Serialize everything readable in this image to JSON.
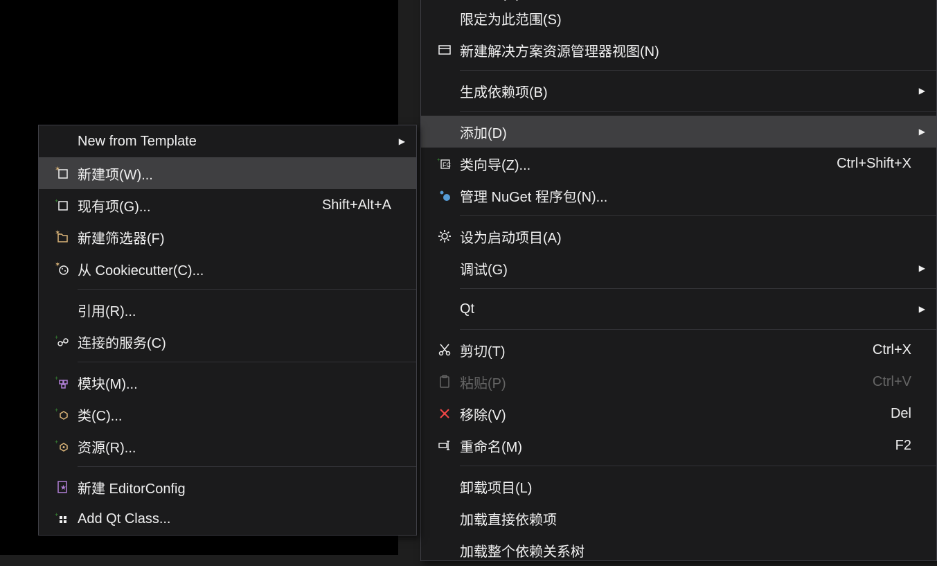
{
  "main_menu": [
    {
      "label": "重建…(R)",
      "icon": "",
      "clipped": true
    },
    {
      "label": "限定为此范围(S)"
    },
    {
      "label": "新建解决方案资源管理器视图(N)",
      "icon": "new-view-icon"
    },
    {
      "sep": true
    },
    {
      "label": "生成依赖项(B)",
      "arrow": true
    },
    {
      "sep": true
    },
    {
      "label": "添加(D)",
      "arrow": true,
      "highlight": true
    },
    {
      "label": "类向导(Z)...",
      "icon": "class-wizard-icon",
      "shortcut": "Ctrl+Shift+X"
    },
    {
      "label": "管理 NuGet 程序包(N)...",
      "icon": "nuget-icon"
    },
    {
      "sep": true
    },
    {
      "label": "设为启动项目(A)",
      "icon": "gear-icon"
    },
    {
      "label": "调试(G)",
      "arrow": true
    },
    {
      "sep": true
    },
    {
      "label": "Qt",
      "arrow": true
    },
    {
      "sep": true
    },
    {
      "label": "剪切(T)",
      "icon": "cut-icon",
      "shortcut": "Ctrl+X"
    },
    {
      "label": "粘贴(P)",
      "icon": "paste-icon",
      "shortcut": "Ctrl+V",
      "disabled": true
    },
    {
      "label": "移除(V)",
      "icon": "remove-icon",
      "shortcut": "Del"
    },
    {
      "label": "重命名(M)",
      "icon": "rename-icon",
      "shortcut": "F2"
    },
    {
      "sep": true
    },
    {
      "label": "卸载项目(L)"
    },
    {
      "label": "加载直接依赖项"
    },
    {
      "label": "加载整个依赖关系树"
    }
  ],
  "sub_menu": [
    {
      "label": "New from Template",
      "arrow": true
    },
    {
      "label": "新建项(W)...",
      "icon": "new-item-icon",
      "highlight": true
    },
    {
      "label": "现有项(G)...",
      "icon": "existing-item-icon",
      "shortcut": "Shift+Alt+A"
    },
    {
      "label": "新建筛选器(F)",
      "icon": "new-filter-icon"
    },
    {
      "label": "从 Cookiecutter(C)...",
      "icon": "cookie-icon"
    },
    {
      "sep": true
    },
    {
      "label": "引用(R)..."
    },
    {
      "label": "连接的服务(C)",
      "icon": "connected-service-icon"
    },
    {
      "sep": true
    },
    {
      "label": "模块(M)...",
      "icon": "module-icon"
    },
    {
      "label": "类(C)...",
      "icon": "class-icon"
    },
    {
      "label": "资源(R)...",
      "icon": "resource-icon"
    },
    {
      "sep": true
    },
    {
      "label": "新建 EditorConfig",
      "icon": "editorconfig-icon"
    },
    {
      "label": "Add Qt Class...",
      "icon": "qt-class-icon"
    }
  ],
  "icons": {
    "arrow": "▶"
  }
}
